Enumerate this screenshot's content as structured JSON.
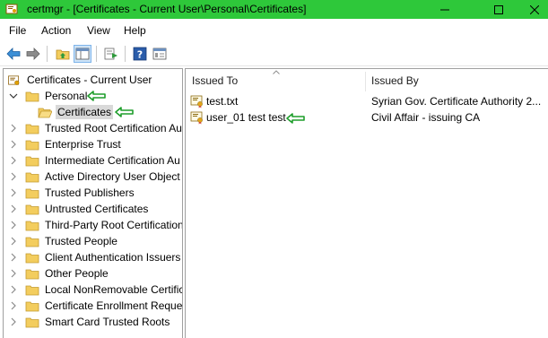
{
  "window": {
    "title": "certmgr - [Certificates - Current User\\Personal\\Certificates]",
    "minimize_label": "—",
    "maximize_label": "☐",
    "close_label": "✕"
  },
  "menu": {
    "items": [
      "File",
      "Action",
      "View",
      "Help"
    ]
  },
  "toolbar": {
    "buttons": [
      "back-icon",
      "forward-icon",
      "up-folder-icon",
      "show-hide-tree-icon",
      "export-list-icon",
      "help-icon",
      "properties-icon"
    ]
  },
  "tree": {
    "root": "Certificates - Current User",
    "items": [
      {
        "label": "Personal",
        "expanded": true
      },
      {
        "label": "Certificates",
        "selected": true
      },
      {
        "label": "Trusted Root Certification Au"
      },
      {
        "label": "Enterprise Trust"
      },
      {
        "label": "Intermediate Certification Au"
      },
      {
        "label": "Active Directory User Object"
      },
      {
        "label": "Trusted Publishers"
      },
      {
        "label": "Untrusted Certificates"
      },
      {
        "label": "Third-Party Root Certification"
      },
      {
        "label": "Trusted People"
      },
      {
        "label": "Client Authentication Issuers"
      },
      {
        "label": "Other People"
      },
      {
        "label": "Local NonRemovable Certific"
      },
      {
        "label": "Certificate Enrollment Reque"
      },
      {
        "label": "Smart Card Trusted Roots"
      }
    ]
  },
  "list": {
    "columns": [
      "Issued To",
      "Issued By"
    ],
    "rows": [
      {
        "issued_to": "test.txt",
        "issued_by": "Syrian Gov. Certificate Authority 2..."
      },
      {
        "issued_to": "user_01 test test",
        "issued_by": "Civil Affair - issuing CA"
      }
    ]
  },
  "colors": {
    "titlebar": "#2ec83a",
    "annotation_arrow": "#1f9e2c",
    "selection": "#d9d9d9",
    "folder": "#f3cd5e"
  }
}
